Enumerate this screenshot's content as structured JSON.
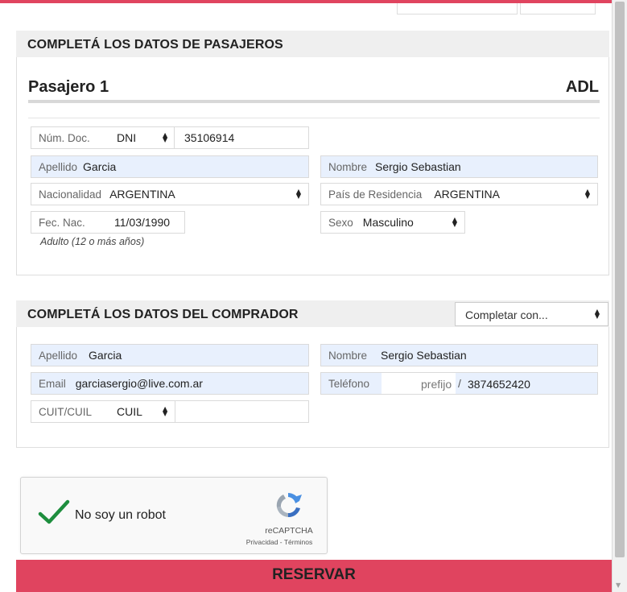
{
  "pasajeros": {
    "section_title": "COMPLETÁ LOS DATOS DE PASAJEROS",
    "passenger_title": "Pasajero 1",
    "passenger_type": "ADL",
    "doc": {
      "label": "Núm. Doc.",
      "type": "DNI",
      "number": "35106914"
    },
    "apellido": {
      "label": "Apellido",
      "value": "Garcia"
    },
    "nombre": {
      "label": "Nombre",
      "value": "Sergio Sebastian"
    },
    "nacionalidad": {
      "label": "Nacionalidad",
      "value": "ARGENTINA"
    },
    "residencia": {
      "label": "País de Residencia",
      "value": "ARGENTINA"
    },
    "fec_nac": {
      "label": "Fec. Nac.",
      "value": "11/03/1990"
    },
    "sexo": {
      "label": "Sexo",
      "value": "Masculino"
    },
    "edad_note": "Adulto (12 o más años)"
  },
  "comprador": {
    "section_title": "COMPLETÁ LOS DATOS DEL COMPRADOR",
    "completar_select": "Completar con...",
    "apellido": {
      "label": "Apellido",
      "value": "Garcia"
    },
    "nombre": {
      "label": "Nombre",
      "value": "Sergio Sebastian"
    },
    "email": {
      "label": "Email",
      "value": "garciasergio@live.com.ar"
    },
    "telefono": {
      "label": "Teléfono",
      "prefix_placeholder": "prefijo",
      "separator": "/",
      "number": "3874652420"
    },
    "cuit": {
      "label": "CUIT/CUIL",
      "type": "CUIL",
      "value": ""
    }
  },
  "captcha": {
    "label": "No soy un robot",
    "brand": "reCAPTCHA",
    "terms": "Privacidad - Términos",
    "checked": true,
    "check_color": "#1e8e3e"
  },
  "actions": {
    "reservar_label": "RESERVAR"
  },
  "colors": {
    "accent": "#e0445f",
    "autofill": "#e8f0fd",
    "section_bg": "#efefef"
  },
  "icons": [
    "checkmark-icon",
    "recaptcha-logo-icon",
    "select-arrows-icon",
    "scroll-down-icon"
  ]
}
